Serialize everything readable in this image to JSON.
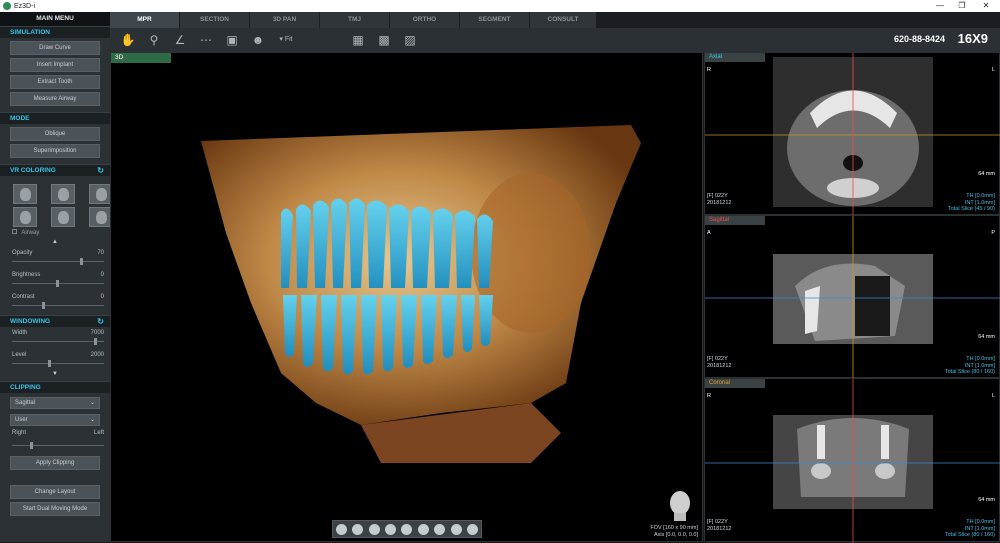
{
  "app": {
    "title": "Ez3D-i"
  },
  "sidebar": {
    "main_menu": "MAIN MENU",
    "simulation": {
      "header": "SIMULATION",
      "buttons": [
        "Draw Curve",
        "Insert Implant",
        "Extract Tooth",
        "Measure Airway"
      ]
    },
    "mode": {
      "header": "MODE",
      "buttons": [
        "Oblique",
        "Superimposition"
      ]
    },
    "vr_coloring": {
      "header": "VR COLORING",
      "airway_label": "Airway",
      "sliders": [
        {
          "label": "Opacity",
          "value": "70"
        },
        {
          "label": "Brightness",
          "value": "0"
        },
        {
          "label": "Contrast",
          "value": "0"
        }
      ]
    },
    "windowing": {
      "header": "WINDOWING",
      "sliders": [
        {
          "label": "Width",
          "value": "7000"
        },
        {
          "label": "Level",
          "value": "2000"
        }
      ]
    },
    "clipping": {
      "header": "CLIPPING",
      "plane_select": "Sagittal",
      "mode_select": "User",
      "side_left": "Right",
      "side_right": "Left",
      "apply_button": "Apply Clipping"
    },
    "change_layout": "Change Layout",
    "dual_moving": "Start Dual Moving Mode"
  },
  "tabs": [
    "MPR",
    "SECTION",
    "3D PAN",
    "TMJ",
    "ORTHO",
    "SEGMENT",
    "CONSULT"
  ],
  "active_tab": "MPR",
  "header": {
    "patient_id": "620-88-8424",
    "fov_size": "16X9"
  },
  "view3d": {
    "label": "3D",
    "fov": "FOV [160 x 90 mm]",
    "axis": "Axis [0.0, 0.0, 0.0]"
  },
  "panels": [
    {
      "label": "Axial",
      "left": "R",
      "right": "L",
      "scale": "64 mm",
      "info": [
        "[F] 022Y",
        "20181212"
      ],
      "stats": [
        "TH [0.0mm]",
        "INT [1.0mm]",
        "Total Slice (45 / 90)"
      ]
    },
    {
      "label": "Sagittal",
      "left": "A",
      "right": "P",
      "scale": "64 mm",
      "info": [
        "[F] 022Y",
        "20181212"
      ],
      "stats": [
        "TH [0.0mm]",
        "INT [1.0mm]",
        "Total Slice (80 / 160)"
      ]
    },
    {
      "label": "Coronal",
      "left": "R",
      "right": "L",
      "scale": "64 mm",
      "info": [
        "[F] 022Y",
        "20181212"
      ],
      "stats": [
        "TH [0.0mm]",
        "INT [1.0mm]",
        "Total Slice (80 / 160)"
      ]
    }
  ],
  "colors": {
    "accent": "#38c4e8",
    "active_tab": "#3f474c",
    "label_3d": "#2f6b46",
    "axial_label": "#38c4e8",
    "sagittal_label": "#e05050",
    "coronal_label": "#e0a030"
  }
}
